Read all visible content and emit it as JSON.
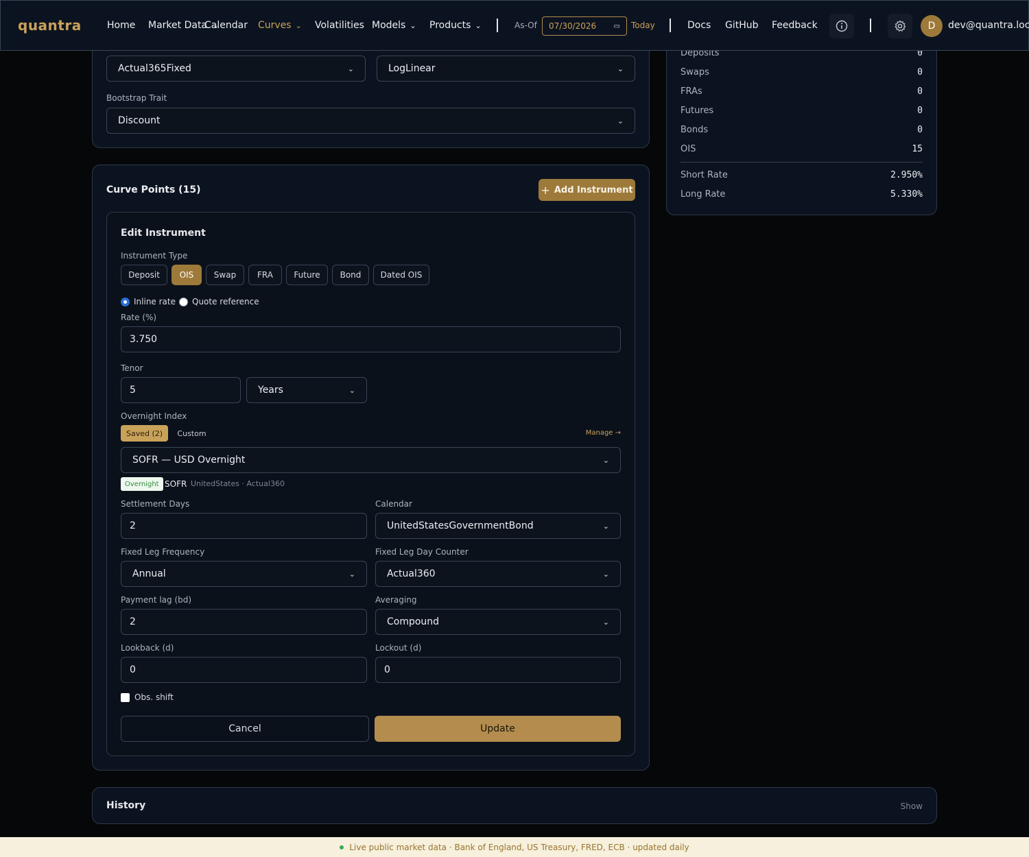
{
  "nav": {
    "logo": "quantra",
    "home": "Home",
    "market_data_1": "Market",
    "market_data_2": "Data",
    "calendar": "Calendar",
    "curves": "Curves",
    "volatilities": "Volatilities",
    "models": "Models",
    "products": "Products",
    "asof_label": "As-Of",
    "asof_date": "07/30/2026",
    "today": "Today",
    "docs": "Docs",
    "github": "GitHub",
    "feedback": "Feedback",
    "avatar_letter": "D",
    "user_email": "dev@quantra.local"
  },
  "config": {
    "day_counter": "Actual365Fixed",
    "interpolator": "LogLinear",
    "bootstrap_label": "Bootstrap Trait",
    "bootstrap_value": "Discount"
  },
  "summary": {
    "rows": [
      {
        "label": "Deposits",
        "value": "0"
      },
      {
        "label": "Swaps",
        "value": "0"
      },
      {
        "label": "FRAs",
        "value": "0"
      },
      {
        "label": "Futures",
        "value": "0"
      },
      {
        "label": "Bonds",
        "value": "0"
      },
      {
        "label": "OIS",
        "value": "15"
      }
    ],
    "short_rate_label": "Short Rate",
    "short_rate": "2.950%",
    "long_rate_label": "Long Rate",
    "long_rate": "5.330%"
  },
  "curve_points": {
    "title": "Curve Points (15)",
    "add_button": "Add Instrument"
  },
  "edit": {
    "title": "Edit Instrument",
    "type_label": "Instrument Type",
    "types": [
      "Deposit",
      "OIS",
      "Swap",
      "FRA",
      "Future",
      "Bond",
      "Dated OIS"
    ],
    "inline_rate": "Inline rate",
    "quote_reference": "Quote reference",
    "rate_label": "Rate (%)",
    "rate_value": "3.750",
    "tenor_label": "Tenor",
    "tenor_value": "5",
    "tenor_unit": "Years",
    "overnight_label": "Overnight Index",
    "saved_tab": "Saved (2)",
    "custom_tab": "Custom",
    "manage": "Manage →",
    "index_select": "SOFR — USD Overnight",
    "badge": "Overnight",
    "index_name": "SOFR",
    "index_meta": "UnitedStates · Actual360",
    "settlement_label": "Settlement Days",
    "settlement_value": "2",
    "calendar_label": "Calendar",
    "calendar_value": "UnitedStatesGovernmentBond",
    "fixed_freq_label": "Fixed Leg Frequency",
    "fixed_freq_value": "Annual",
    "fixed_dc_label": "Fixed Leg Day Counter",
    "fixed_dc_value": "Actual360",
    "payment_lag_label": "Payment lag (bd)",
    "payment_lag_value": "2",
    "averaging_label": "Averaging",
    "averaging_value": "Compound",
    "lookback_label": "Lookback (d)",
    "lookback_value": "0",
    "lockout_label": "Lockout (d)",
    "lockout_value": "0",
    "obs_shift": "Obs. shift",
    "cancel": "Cancel",
    "update": "Update"
  },
  "history": {
    "title": "History",
    "show": "Show"
  },
  "footer": {
    "text": "Live public market data · Bank of England, US Treasury, FRED, ECB · updated daily"
  },
  "colors": {
    "accent": "#c9a25a",
    "button_gold": "#9d7a3a",
    "background": "#050709",
    "card": "#0c1320"
  }
}
